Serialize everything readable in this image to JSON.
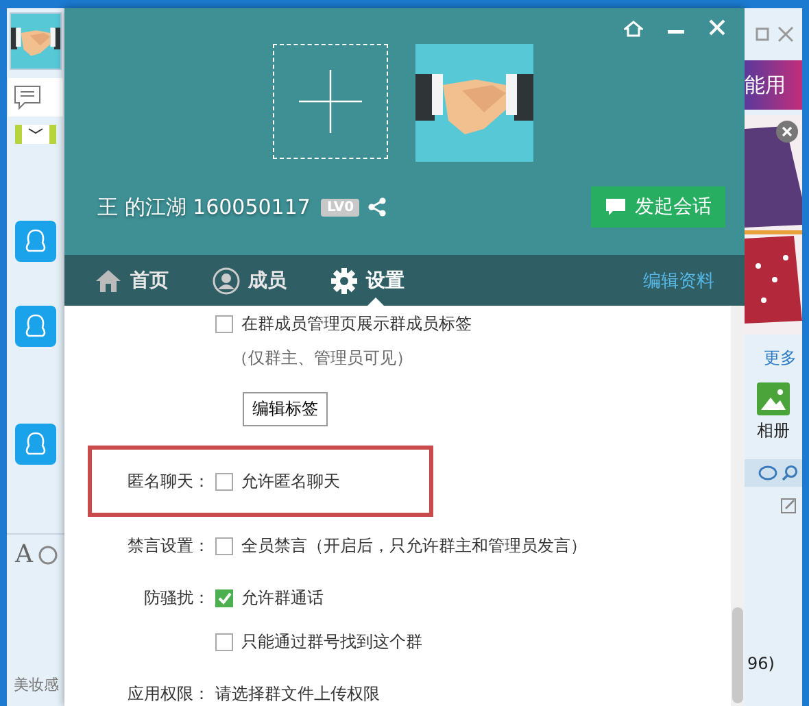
{
  "back_window": {
    "left_toolbar": {
      "font_button": "A",
      "preview_text": "美妆感"
    },
    "right_panel": {
      "banner": "能用",
      "more_link": "更多",
      "album_label": "相册",
      "partial_text": "96)"
    }
  },
  "group_dialog": {
    "group_name": "王 的江湖 160050117",
    "level_badge": "LV0",
    "start_chat_button": "发起会话",
    "tabs": [
      {
        "label": "首页",
        "kind": "home",
        "selected": false
      },
      {
        "label": "成员",
        "kind": "person",
        "selected": false
      },
      {
        "label": "设置",
        "kind": "gear",
        "selected": true
      }
    ],
    "edit_profile_link": "编辑资料",
    "settings": [
      {
        "kind": "checkbox",
        "text": "在群成员管理页展示群成员标签",
        "checked": false,
        "highlighted": false
      },
      {
        "kind": "note",
        "text": "（仅群主、管理员可见）"
      },
      {
        "kind": "button",
        "text": "编辑标签"
      },
      {
        "kind": "checkbox",
        "label": "匿名聊天：",
        "text": "允许匿名聊天",
        "checked": false,
        "highlighted": true
      },
      {
        "kind": "checkbox",
        "label": "禁言设置：",
        "text": "全员禁言（开启后，只允许群主和管理员发言）",
        "checked": false,
        "highlighted": false
      },
      {
        "kind": "checkbox",
        "label": "防骚扰：",
        "text": "允许群通话",
        "checked": true,
        "highlighted": false
      },
      {
        "kind": "checkbox",
        "text": "只能通过群号找到这个群",
        "checked": false,
        "highlighted": false
      },
      {
        "kind": "text",
        "label": "应用权限：",
        "text": "请选择群文件上传权限"
      }
    ]
  }
}
